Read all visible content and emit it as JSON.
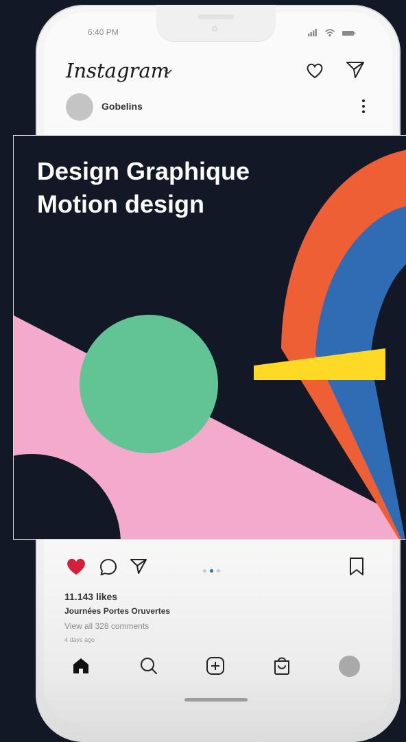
{
  "status_bar": {
    "time": "6:40 PM",
    "icons": [
      "signal-icon",
      "wifi-icon",
      "battery-icon"
    ]
  },
  "header": {
    "app_name": "Instagram",
    "icons": [
      "chevron-down-icon",
      "heart-icon",
      "direct-message-icon"
    ]
  },
  "post": {
    "username": "Gobelins",
    "menu_icon": "more-vertical-icon",
    "image_title": "Design Graphique\nMotion design",
    "colors": {
      "background": "#121826",
      "orange": "#ef5f35",
      "blue": "#306cb3",
      "yellow": "#fed925",
      "green": "#62c394",
      "pink": "#f4aacb"
    },
    "carousel": {
      "count": 3,
      "active_index": 1
    },
    "likes": "11.143 likes",
    "caption": "Journées Portes Oruvertes",
    "comments": "View all 328 comments",
    "time_ago": "4 days ago",
    "liked": true,
    "action_icons": [
      "heart-filled-icon",
      "comment-icon",
      "share-icon",
      "bookmark-icon"
    ]
  },
  "bottom_nav": {
    "items": [
      "home-icon",
      "search-icon",
      "add-post-icon",
      "shop-icon",
      "profile-avatar"
    ]
  }
}
